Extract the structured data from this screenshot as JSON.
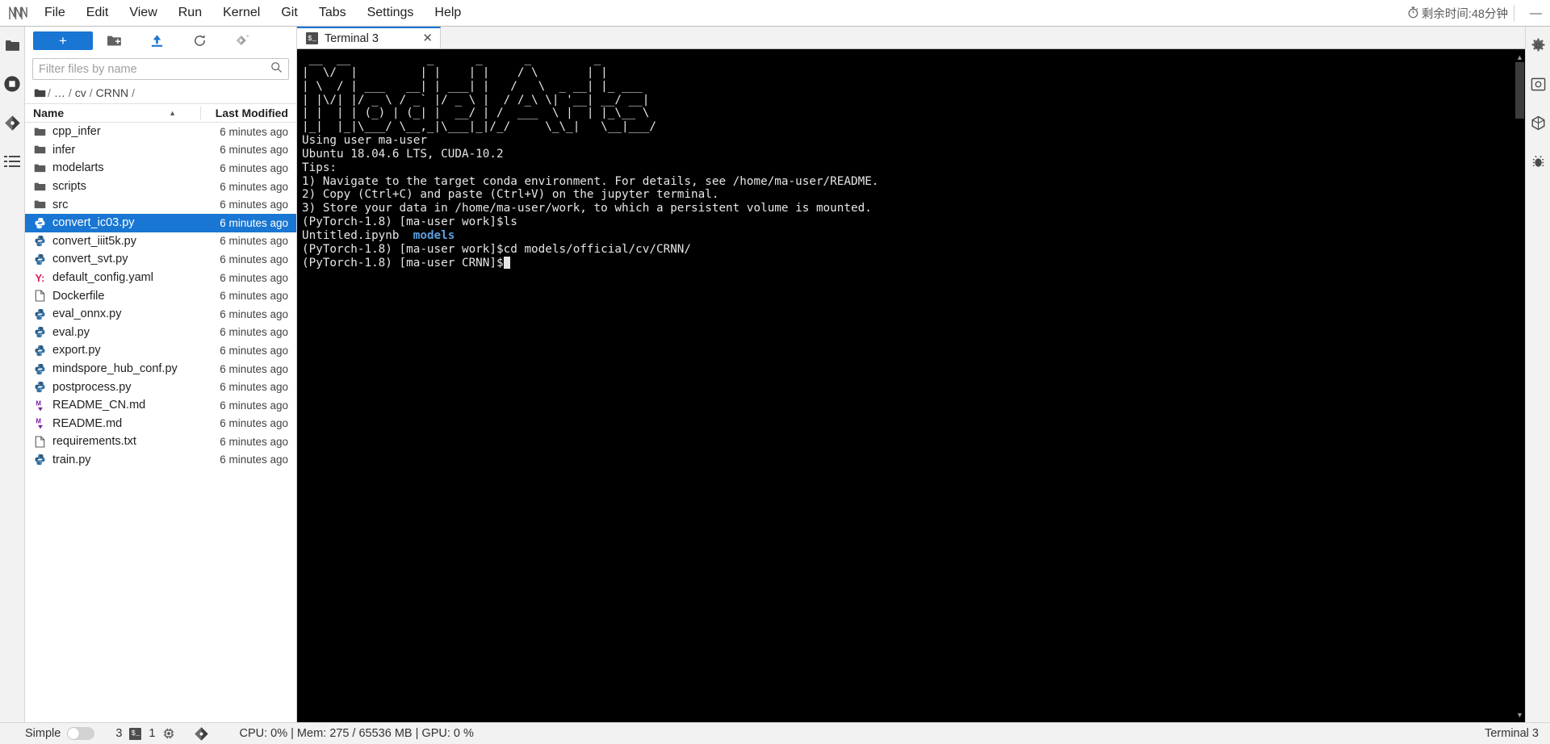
{
  "menubar": {
    "logo": "jupyterlab-logo",
    "items": [
      "File",
      "Edit",
      "View",
      "Run",
      "Kernel",
      "Git",
      "Tabs",
      "Settings",
      "Help"
    ],
    "timer_text": "剩余时间:48分钟",
    "timer_icon": "stopwatch-icon",
    "minimize_label": "—"
  },
  "left_rail": [
    {
      "name": "file-browser-icon",
      "glyph": "folder"
    },
    {
      "name": "running-terminals-icon",
      "glyph": "stop"
    },
    {
      "name": "git-icon",
      "glyph": "git"
    },
    {
      "name": "table-of-contents-icon",
      "glyph": "toc"
    }
  ],
  "right_rail": [
    {
      "name": "settings-gear-icon",
      "glyph": "gear"
    },
    {
      "name": "property-inspector-icon",
      "glyph": "inspector"
    },
    {
      "name": "extension-manager-icon",
      "glyph": "extension"
    },
    {
      "name": "debugger-icon",
      "glyph": "bug"
    }
  ],
  "filebrowser": {
    "new_launcher_label": "+",
    "toolbar_icons": [
      {
        "name": "new-folder-icon"
      },
      {
        "name": "upload-icon"
      },
      {
        "name": "refresh-icon"
      },
      {
        "name": "git-clone-icon"
      }
    ],
    "filter_placeholder": "Filter files by name",
    "filter_value": "",
    "search_icon": "search-icon",
    "breadcrumb": [
      "/",
      "…",
      "/",
      "cv",
      "/",
      "CRNN",
      "/"
    ],
    "columns": {
      "name": "Name",
      "last_modified": "Last Modified"
    },
    "sort_caret": "▲",
    "rows": [
      {
        "name": "cpp_infer",
        "type": "folder",
        "modified": "6 minutes ago",
        "selected": false
      },
      {
        "name": "infer",
        "type": "folder",
        "modified": "6 minutes ago",
        "selected": false
      },
      {
        "name": "modelarts",
        "type": "folder",
        "modified": "6 minutes ago",
        "selected": false
      },
      {
        "name": "scripts",
        "type": "folder",
        "modified": "6 minutes ago",
        "selected": false
      },
      {
        "name": "src",
        "type": "folder",
        "modified": "6 minutes ago",
        "selected": false
      },
      {
        "name": "convert_ic03.py",
        "type": "python",
        "modified": "6 minutes ago",
        "selected": true
      },
      {
        "name": "convert_iiit5k.py",
        "type": "python",
        "modified": "6 minutes ago",
        "selected": false
      },
      {
        "name": "convert_svt.py",
        "type": "python",
        "modified": "6 minutes ago",
        "selected": false
      },
      {
        "name": "default_config.yaml",
        "type": "yaml",
        "modified": "6 minutes ago",
        "selected": false
      },
      {
        "name": "Dockerfile",
        "type": "file",
        "modified": "6 minutes ago",
        "selected": false
      },
      {
        "name": "eval_onnx.py",
        "type": "python",
        "modified": "6 minutes ago",
        "selected": false
      },
      {
        "name": "eval.py",
        "type": "python",
        "modified": "6 minutes ago",
        "selected": false
      },
      {
        "name": "export.py",
        "type": "python",
        "modified": "6 minutes ago",
        "selected": false
      },
      {
        "name": "mindspore_hub_conf.py",
        "type": "python",
        "modified": "6 minutes ago",
        "selected": false
      },
      {
        "name": "postprocess.py",
        "type": "python",
        "modified": "6 minutes ago",
        "selected": false
      },
      {
        "name": "README_CN.md",
        "type": "markdown",
        "modified": "6 minutes ago",
        "selected": false
      },
      {
        "name": "README.md",
        "type": "markdown",
        "modified": "6 minutes ago",
        "selected": false
      },
      {
        "name": "requirements.txt",
        "type": "file",
        "modified": "6 minutes ago",
        "selected": false
      },
      {
        "name": "train.py",
        "type": "python",
        "modified": "6 minutes ago",
        "selected": false
      }
    ]
  },
  "dock": {
    "tabs": [
      {
        "label": "Terminal 3",
        "icon": "terminal-icon",
        "close_glyph": "✕",
        "active": true
      }
    ]
  },
  "terminal": {
    "banner_lines": [
      " __  __           _      _      _         _      ",
      "|  \\/  |         | |    | |    / \\       | |     ",
      "| \\  / | ___   __| | ___| |   /   \\  _ __| |_ ___",
      "| |\\/| |/ _ \\ / _` |/ _ \\ |  / /_\\ \\| '__| __/ __|",
      "| |  | | (_) | (_| |  __/ | /  ___  \\ |  | |_\\__ \\",
      "|_|  |_|\\___/ \\__,_|\\___|_|/_/     \\_\\_|   \\__|___/"
    ],
    "lines": [
      {
        "text": "Using user ma-user"
      },
      {
        "text": "Ubuntu 18.04.6 LTS, CUDA-10.2"
      },
      {
        "text": "Tips:"
      },
      {
        "text": "1) Navigate to the target conda environment. For details, see /home/ma-user/README."
      },
      {
        "text": "2) Copy (Ctrl+C) and paste (Ctrl+V) on the jupyter terminal."
      },
      {
        "text": "3) Store your data in /home/ma-user/work, to which a persistent volume is mounted."
      },
      {
        "text": "(PyTorch-1.8) [ma-user work]$ls"
      }
    ],
    "ls_output": {
      "plain": "Untitled.ipynb  ",
      "dir": "models"
    },
    "cd_line": "(PyTorch-1.8) [ma-user work]$cd models/official/cv/CRNN/",
    "prompt_line": "(PyTorch-1.8) [ma-user CRNN]$",
    "scroll_up_glyph": "▲",
    "scroll_down_glyph": "▼"
  },
  "statusbar": {
    "mode_label": "Simple",
    "toggle_state": "off",
    "terminal_count": "3",
    "terminal_icon": "terminal-icon",
    "kernel_count": "1",
    "kernel_icon": "kernel-icon",
    "git_icon": "git-icon",
    "system_info": "CPU: 0% | Mem: 275 / 65536 MB | GPU: 0 %",
    "right_label": "Terminal 3"
  },
  "colors": {
    "accent": "#1976d2",
    "selected_row": "#1976d2",
    "terminal_bg": "#000000",
    "terminal_fg": "#e6e6e6",
    "terminal_dir": "#5c9fe0",
    "python_icon": "#2b5b84",
    "yaml_icon": "#d81b60",
    "markdown_icon": "#7b1fa2",
    "chrome_bg": "#f2f2f2"
  }
}
